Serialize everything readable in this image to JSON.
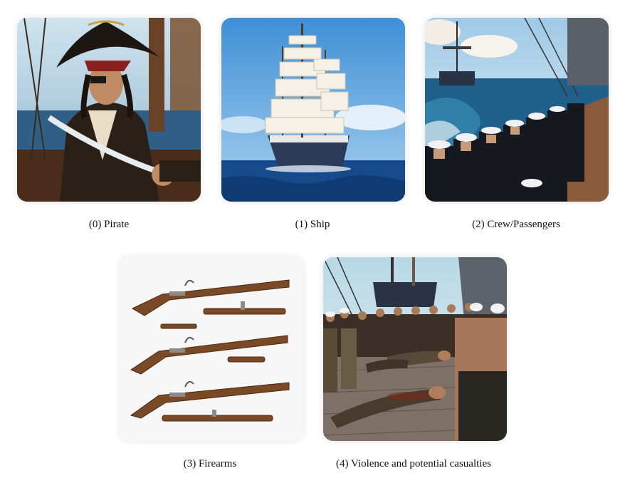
{
  "items": [
    {
      "caption": "(0) Pirate"
    },
    {
      "caption": "(1) Ship"
    },
    {
      "caption": "(2) Crew/Passengers"
    },
    {
      "caption": "(3) Firearms"
    },
    {
      "caption": "(4) Violence and potential casualties"
    }
  ]
}
